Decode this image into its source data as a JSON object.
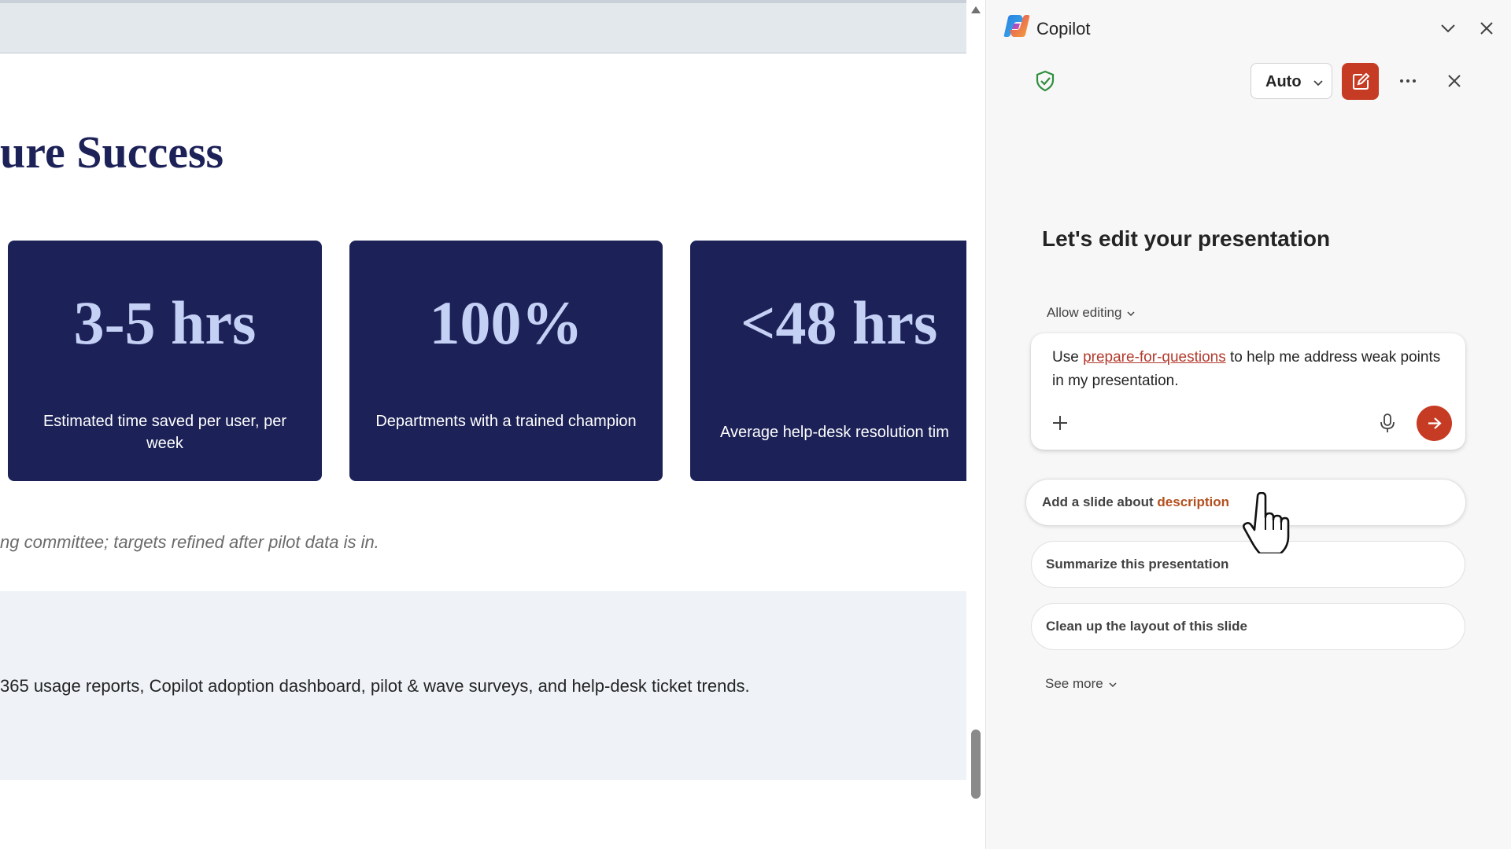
{
  "slide": {
    "heading": "ure Success",
    "metrics": [
      {
        "value": "3-5 hrs",
        "label": "Estimated time saved per user, per week"
      },
      {
        "value": "100%",
        "label": "Departments with a trained champion"
      },
      {
        "value": "<48 hrs",
        "label": "Average help-desk resolution tim"
      }
    ],
    "note": "ng committee; targets refined after pilot data is in.",
    "sources": "365 usage reports, Copilot adoption dashboard, pilot & wave surveys, and help-desk ticket trends."
  },
  "copilot": {
    "app_title": "Copilot",
    "mode_label": "Auto",
    "greeting": "Let's edit your presentation",
    "allow_editing": "Allow editing",
    "prompt": {
      "before": "Use ",
      "link": "prepare-for-questions",
      "after": " to help me address weak points in my presentation."
    },
    "suggestions": [
      {
        "text": "Add a slide about ",
        "placeholder": "description"
      },
      {
        "text": "Summarize this presentation"
      },
      {
        "text": "Clean up the layout of this slide"
      }
    ],
    "see_more": "See more"
  },
  "colors": {
    "navy": "#1c2157",
    "metric_value": "#c5d0f5",
    "accent": "#c63b23",
    "link": "#b33a2d",
    "shield": "#2e8f3e"
  },
  "icons": [
    "copilot-logo-icon",
    "chevron-down-icon",
    "close-icon",
    "shield-check-icon",
    "edit-icon",
    "more-icon",
    "plus-icon",
    "microphone-icon",
    "arrow-right-icon",
    "hand-pointer-cursor-icon"
  ]
}
